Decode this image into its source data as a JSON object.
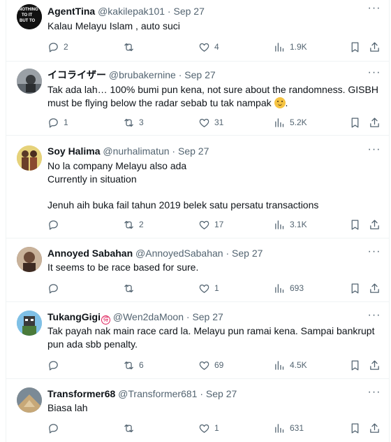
{
  "tweets": [
    {
      "name": "AgentTina",
      "handle": "@kakilepak101",
      "separator": "·",
      "date": "Sep 27",
      "text": "Kalau Melayu Islam , auto suci",
      "replies": "2",
      "retweets": "",
      "likes": "4",
      "views": "1.9K",
      "avatar": {
        "bg": "#111111",
        "caption": "NOTHING TO IT BUT TO"
      }
    },
    {
      "name": "イコライザー",
      "handle": "@brubakernine",
      "separator": "·",
      "date": "Sep 27",
      "text": "Tak ada lah… 100% bumi pun kena, not sure about the randomness. GISBH must be flying below the radar sebab tu tak nampak",
      "text_after_emoji": ".",
      "emoji": "wink-tongue-face",
      "replies": "1",
      "retweets": "3",
      "likes": "31",
      "views": "5.2K",
      "avatar": {
        "bg": "#8a8f96"
      }
    },
    {
      "name": "Soy Halima",
      "handle": "@nurhalimatun",
      "separator": "·",
      "date": "Sep 27",
      "text": "No la company Melayu also ada\nCurrently in situation\n\nJenuh aih buka fail tahun 2019 belek satu persatu transactions",
      "replies": "",
      "retweets": "2",
      "likes": "17",
      "views": "3.1K",
      "avatar": {
        "bg": "#d9c46a"
      }
    },
    {
      "name": "Annoyed Sabahan",
      "handle": "@AnnoyedSabahan",
      "separator": "·",
      "date": "Sep 27",
      "text": "It seems to be race based for sure.",
      "replies": "",
      "retweets": "",
      "likes": "1",
      "views": "693",
      "avatar": {
        "bg": "#7a5a48"
      }
    },
    {
      "name": "TukangGigi",
      "badge": "得",
      "handle": "@Wen2daMoon",
      "separator": "·",
      "date": "Sep 27",
      "text": "Tak payah nak main race card la. Melayu pun ramai kena. Sampai bankrupt pun ada sbb penalty.",
      "replies": "",
      "retweets": "6",
      "likes": "69",
      "views": "4.5K",
      "avatar": {
        "bg": "#6cb0d8"
      }
    },
    {
      "name": "Transformer68",
      "handle": "@Transformer681",
      "separator": "·",
      "date": "Sep 27",
      "text": "Biasa lah",
      "replies": "",
      "retweets": "",
      "likes": "1",
      "views": "631",
      "avatar": {
        "bg": "#b8a584"
      }
    }
  ],
  "icons": {
    "reply": "reply-icon",
    "retweet": "retweet-icon",
    "like": "heart-icon",
    "views": "views-icon",
    "bookmark": "bookmark-icon",
    "share": "share-icon",
    "more": "more-icon"
  },
  "colors": {
    "text": "#0f1419",
    "muted": "#536471",
    "border": "#eff3f4",
    "badge": "#e0245e"
  }
}
